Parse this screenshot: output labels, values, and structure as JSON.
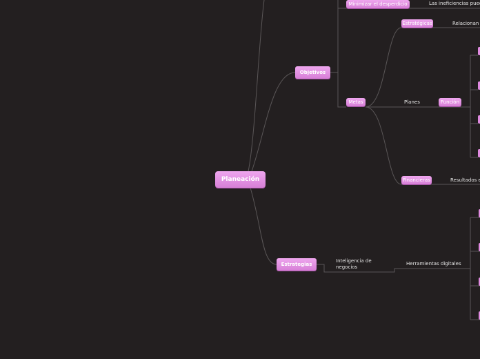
{
  "colors": {
    "background": "#231f20",
    "node": "#e08ae0",
    "line": "#5a5657"
  },
  "root": {
    "label": "Planeación"
  },
  "objetivos": {
    "label": "Objetivos",
    "children": [
      {
        "label": "Minimizar el desperdicio",
        "note": "Las ineficiencias pueden"
      },
      {
        "label": "Metas",
        "children": [
          {
            "label": "Estratégicas",
            "note": "Relacionan"
          },
          {
            "label": "Función",
            "connector": "Planes"
          },
          {
            "label": "Financieras",
            "note": "Resultados e"
          }
        ]
      }
    ]
  },
  "estrategias": {
    "label": "Estrategias",
    "child": "Inteligencia de negocios",
    "grandchild": "Herramientas digitales"
  }
}
